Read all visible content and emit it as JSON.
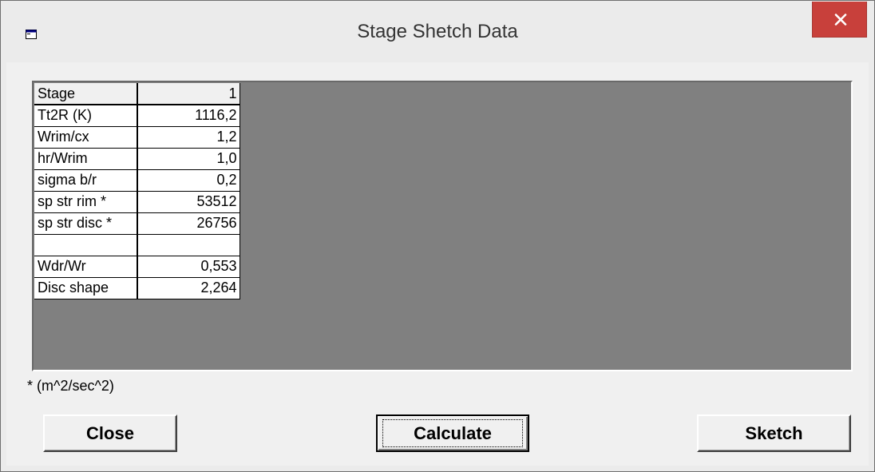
{
  "window": {
    "title": "Stage Shetch Data",
    "app_icon": "window-app-icon",
    "close_icon": "close-icon",
    "close_color": "#c8403b"
  },
  "grid": {
    "header": {
      "label": "Stage",
      "value": "1"
    },
    "rows": [
      {
        "label": "Tt2R (K)",
        "value": "1116,2"
      },
      {
        "label": "Wrim/cx",
        "value": "1,2"
      },
      {
        "label": "hr/Wrim",
        "value": "1,0"
      },
      {
        "label": "sigma b/r",
        "value": "0,2"
      },
      {
        "label": "sp str rim   *",
        "value": "53512"
      },
      {
        "label": "sp str disc *",
        "value": "26756"
      },
      {
        "label": "",
        "value": ""
      },
      {
        "label": "Wdr/Wr",
        "value": "0,553"
      },
      {
        "label": "Disc shape",
        "value": "2,264"
      }
    ],
    "background_color": "#808080"
  },
  "footnote": "* (m^2/sec^2)",
  "buttons": {
    "close_label": "Close",
    "calculate_label": "Calculate",
    "sketch_label": "Sketch"
  }
}
